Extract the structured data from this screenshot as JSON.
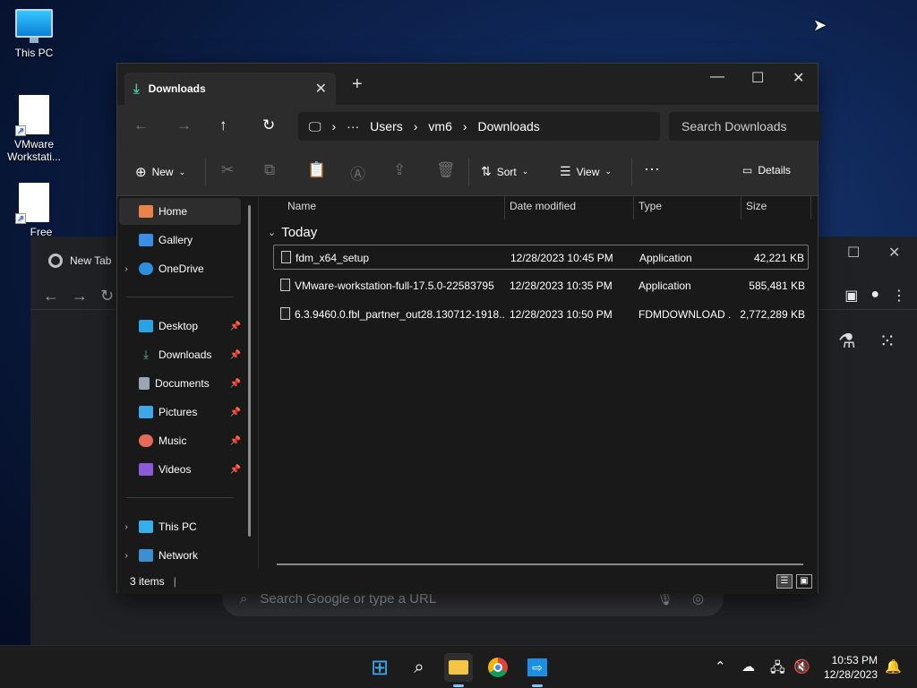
{
  "desktop": {
    "icons": [
      {
        "label": "This PC"
      },
      {
        "label": "VMware Workstati..."
      },
      {
        "label": "Free Dov"
      }
    ]
  },
  "chrome": {
    "tab_title": "New Tab",
    "omnibox_placeholder": "Search Google or type a URL"
  },
  "explorer": {
    "tab_title": "Downloads",
    "breadcrumb": [
      "Users",
      "vm6",
      "Downloads"
    ],
    "search_placeholder": "Search Downloads",
    "commands": {
      "new": "New",
      "sort": "Sort",
      "view": "View",
      "details": "Details"
    },
    "nav": {
      "home": "Home",
      "gallery": "Gallery",
      "onedrive": "OneDrive",
      "desktop": "Desktop",
      "downloads": "Downloads",
      "documents": "Documents",
      "pictures": "Pictures",
      "music": "Music",
      "videos": "Videos",
      "thispc": "This PC",
      "network": "Network"
    },
    "columns": {
      "name": "Name",
      "date": "Date modified",
      "type": "Type",
      "size": "Size"
    },
    "group": "Today",
    "files": [
      {
        "name": "fdm_x64_setup",
        "date": "12/28/2023 10:45 PM",
        "type": "Application",
        "size": "42,221 KB"
      },
      {
        "name": "VMware-workstation-full-17.5.0-22583795",
        "date": "12/28/2023 10:35 PM",
        "type": "Application",
        "size": "585,481 KB"
      },
      {
        "name": "6.3.9460.0.fbl_partner_out28.130712-1918...",
        "date": "12/28/2023 10:50 PM",
        "type": "FDMDOWNLOAD ...",
        "size": "2,772,289 KB"
      }
    ],
    "status": "3 items"
  },
  "taskbar": {
    "time": "10:53 PM",
    "date": "12/28/2023"
  }
}
